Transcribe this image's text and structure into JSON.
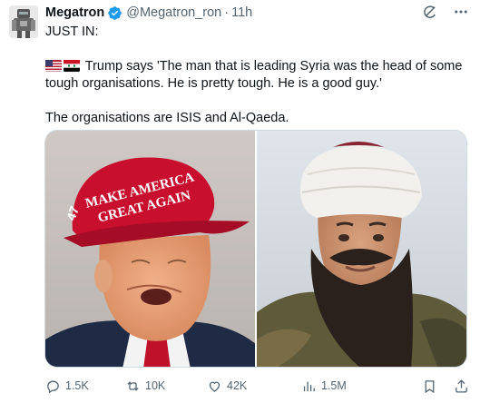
{
  "author": {
    "name": "Megatron",
    "handle": "@Megatron_ron",
    "separator": "·",
    "time": "11h"
  },
  "post": {
    "line1": "JUST IN:",
    "line2_flags": [
      "us-flag",
      "syria-flag"
    ],
    "line2": " Trump says 'The man that is leading Syria was the head of some",
    "line3": "tough organisations. He is pretty tough. He is a good guy.'",
    "line4": "The organisations are ISIS and Al-Qaeda."
  },
  "media": {
    "left_cap_text_1": "MAKE AMERICA",
    "left_cap_text_2": "GREAT AGAIN",
    "left_cap_side": "47"
  },
  "actions": {
    "replies": "1.5K",
    "reposts": "10K",
    "likes": "42K",
    "views": "1.5M"
  },
  "colors": {
    "text": "#0f1419",
    "muted": "#536471",
    "verified": "#1d9bf0",
    "border": "#cfd9de"
  },
  "icons": {
    "verified": "verified-badge-icon",
    "grok": "grok-icon",
    "more": "more-icon",
    "reply": "reply-icon",
    "repost": "repost-icon",
    "like": "like-icon",
    "views": "views-icon",
    "bookmark": "bookmark-icon",
    "share": "share-icon"
  }
}
